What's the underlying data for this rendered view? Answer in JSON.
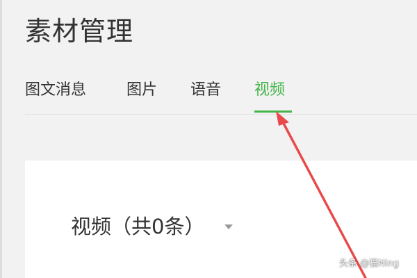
{
  "page": {
    "title": "素材管理"
  },
  "tabs": [
    {
      "label": "图文消息",
      "active": false
    },
    {
      "label": "图片",
      "active": false
    },
    {
      "label": "语音",
      "active": false
    },
    {
      "label": "视频",
      "active": true
    }
  ],
  "content": {
    "section_header": "视频（共0条）"
  },
  "annotation": {
    "arrow_color": "#e84a4a"
  },
  "watermark": {
    "text": "头条 @猫Ning"
  },
  "colors": {
    "accent": "#44b549",
    "text": "#333333",
    "background": "#f2f2f2",
    "card": "#ffffff"
  }
}
